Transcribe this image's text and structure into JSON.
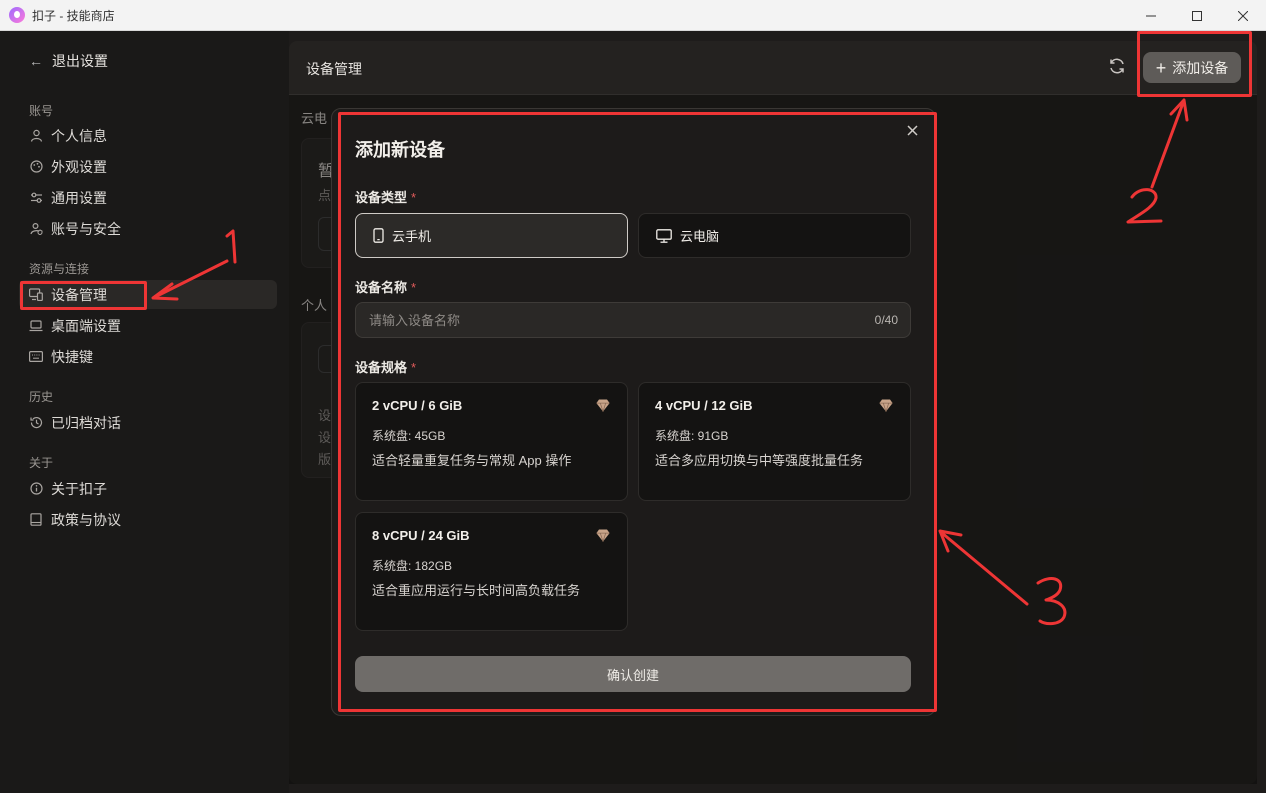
{
  "window": {
    "title": "扣子 - 技能商店",
    "controls": [
      "minimize",
      "maximize",
      "close"
    ]
  },
  "sidebar": {
    "back_label": "退出设置",
    "groups": [
      {
        "label": "账号"
      },
      {
        "label": "资源与连接"
      },
      {
        "label": "历史"
      },
      {
        "label": "关于"
      }
    ],
    "items": [
      {
        "label": "个人信息",
        "icon": "user-icon"
      },
      {
        "label": "外观设置",
        "icon": "palette-icon"
      },
      {
        "label": "通用设置",
        "icon": "sliders-icon"
      },
      {
        "label": "账号与安全",
        "icon": "user-shield-icon"
      },
      {
        "label": "设备管理",
        "icon": "devices-icon",
        "active": true
      },
      {
        "label": "桌面端设置",
        "icon": "laptop-icon"
      },
      {
        "label": "快捷键",
        "icon": "keyboard-icon"
      },
      {
        "label": "已归档对话",
        "icon": "archive-icon"
      },
      {
        "label": "关于扣子",
        "icon": "info-icon"
      },
      {
        "label": "政策与协议",
        "icon": "book-icon"
      }
    ]
  },
  "main": {
    "title": "设备管理",
    "add_button_label": "添加设备",
    "bg_fragments": {
      "section1": "云电",
      "card_t": "暂",
      "card_s": "点",
      "section2": "个人",
      "l1": "设",
      "l2": "设",
      "l3": "版"
    }
  },
  "modal": {
    "title": "添加新设备",
    "type_label": "设备类型",
    "required_mark": "*",
    "types": [
      {
        "label": "云手机",
        "icon": "phone-icon",
        "selected": true
      },
      {
        "label": "云电脑",
        "icon": "monitor-icon",
        "selected": false
      }
    ],
    "name_label": "设备名称",
    "name_placeholder": "请输入设备名称",
    "name_value": "",
    "name_counter": "0/40",
    "spec_label": "设备规格",
    "specs": [
      {
        "name": "2 vCPU / 6 GiB",
        "disk": "系统盘: 45GB",
        "desc": "适合轻量重复任务与常规 App 操作"
      },
      {
        "name": "4 vCPU / 12 GiB",
        "disk": "系统盘: 91GB",
        "desc": "适合多应用切换与中等强度批量任务"
      },
      {
        "name": "8 vCPU / 24 GiB",
        "disk": "系统盘: 182GB",
        "desc": "适合重应用运行与长时间高负载任务"
      }
    ],
    "confirm_label": "确认创建"
  },
  "annotations": {
    "colors": {
      "red": "#ee3535"
    }
  }
}
